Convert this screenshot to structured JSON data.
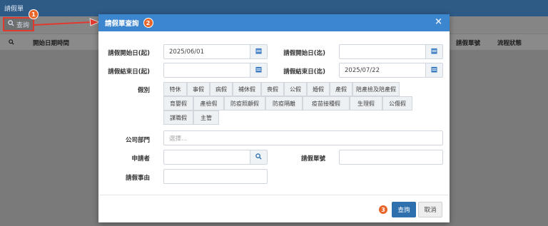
{
  "page": {
    "title": "請假單"
  },
  "toolbar": {
    "query_label": "查詢"
  },
  "table": {
    "headers": [
      "開始日期時間",
      "請假單號",
      "流程狀態"
    ]
  },
  "markers": [
    "1",
    "2",
    "3"
  ],
  "modal": {
    "title": "請假單查詢",
    "close_glyph": "×",
    "start_from_label": "請假開始日(起)",
    "start_from_value": "2025/06/01",
    "start_to_label": "請假開始日(迄)",
    "start_to_value": "",
    "end_from_label": "請假結束日(起)",
    "end_from_value": "",
    "end_to_label": "請假結束日(迄)",
    "end_to_value": "2025/07/22",
    "leave_type_label": "假別",
    "leave_types": [
      "特休",
      "事假",
      "病假",
      "補休假",
      "喪假",
      "公假",
      "婚假",
      "產假",
      "陪產檢及陪產假",
      "育嬰假",
      "產檢假",
      "防疫照顧假",
      "防疫隔離",
      "疫苗接種假",
      "生理假",
      "公傷假",
      "謀職假",
      "主管"
    ],
    "dept_label": "公司部門",
    "dept_placeholder": "選擇...",
    "applicant_label": "申請者",
    "applicant_value": "",
    "form_no_label": "請假單號",
    "form_no_value": "",
    "reason_label": "請假事由",
    "reason_value": "",
    "query_button": "查詢",
    "cancel_button": "取消"
  },
  "colors": {
    "header": "#3c86cf",
    "primary_button": "#2e6fae",
    "marker": "#e8662a",
    "highlight": "#e03a2f"
  },
  "icons": [
    "search-icon",
    "calendar-icon",
    "close-icon",
    "arrow-icon"
  ]
}
